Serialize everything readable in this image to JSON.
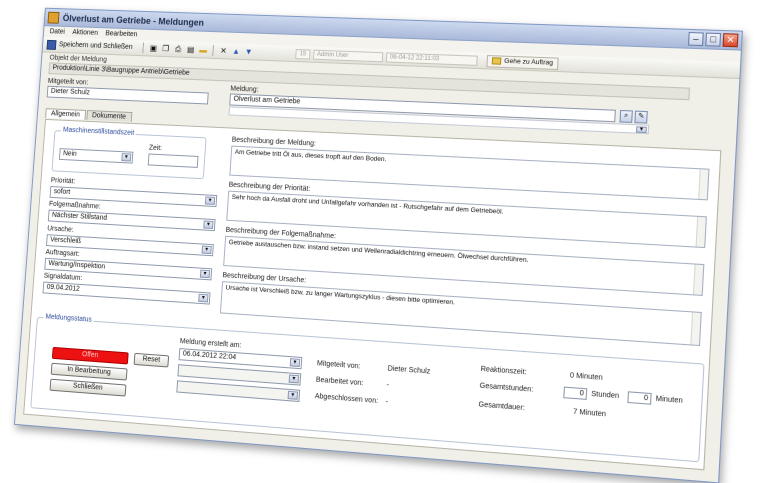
{
  "window": {
    "title": "Ölverlust am Getriebe - Meldungen"
  },
  "menu": [
    "Datei",
    "Aktionen",
    "Bearbeiten"
  ],
  "toolbar": {
    "save_close_label": "Speichern und Schließen",
    "id_box": "15",
    "user_box": "Admin User",
    "date_box": "06-04-12 22:11:03",
    "goto_label": "Gehe zu Auftrag"
  },
  "object": {
    "header": "Objekt der Meldung",
    "path": "Produktion\\Linie 3\\Baugruppe Antrieb\\Getriebe"
  },
  "reported_by": {
    "label": "Mitgeteilt von:",
    "value": "Dieter Schulz"
  },
  "message": {
    "label": "Meldung:",
    "value": "Ölverlust am Getriebe"
  },
  "tabs": [
    "Allgemein",
    "Dokumente"
  ],
  "machine_stop": {
    "title": "Maschinenstillstandszeit",
    "value": "Nein",
    "time_label": "Zeit:"
  },
  "priority": {
    "label": "Priorität:",
    "value": "sofort"
  },
  "followup": {
    "label": "Folgemaßnahme:",
    "value": "Nächster Stillstand"
  },
  "cause": {
    "label": "Ursache:",
    "value": "Verschleiß"
  },
  "order_type": {
    "label": "Auftragsart:",
    "value": "Wartung/Inspektion"
  },
  "signal_date": {
    "label": "Signaldatum:",
    "value": "09.04.2012"
  },
  "desc_message": {
    "label": "Beschreibung der Meldung:",
    "text": "Am Getriebe tritt Öl aus, dieses tropft auf den Boden."
  },
  "desc_priority": {
    "label": "Beschreibung der Priorität:",
    "text": "Sehr hoch da Ausfall droht und Unfallgefahr vorhanden ist - Rutschgefahr auf dem Getriebeöl."
  },
  "desc_followup": {
    "label": "Beschreibung der Folgemaßnahme:",
    "text": "Getriebe austauschen bzw. instand setzen und Wellenradialdichtring erneuern. Ölwechsel durchführen."
  },
  "desc_cause": {
    "label": "Beschreibung der Ursache:",
    "text": "Ursache ist Verschleiß bzw. zu langer Wartungszyklus - diesen bitte optimieren."
  },
  "status": {
    "title": "Meldungsstatus",
    "open_label": "Offen",
    "reset_label": "Reset",
    "in_progress_label": "In Bearbeitung",
    "close_label": "Schließen",
    "created_label": "Meldung erstellt am:",
    "created_value": "06.04.2012 22:04",
    "reported_by_label": "Mitgeteilt von:",
    "reported_by_value": "Dieter Schulz",
    "processed_by_label": "Bearbeitet von:",
    "processed_by_value": "-",
    "closed_by_label": "Abgeschlossen von:",
    "closed_by_value": "-",
    "reaction_label": "Reaktionszeit:",
    "reaction_value": "0 Minuten",
    "total_hours_label": "Gesamtstunden:",
    "hours_value": "0",
    "hours_unit": "Stunden",
    "minutes_value": "0",
    "minutes_unit": "Minuten",
    "total_duration_label": "Gesamtdauer:",
    "total_duration_value": "7 Minuten"
  }
}
